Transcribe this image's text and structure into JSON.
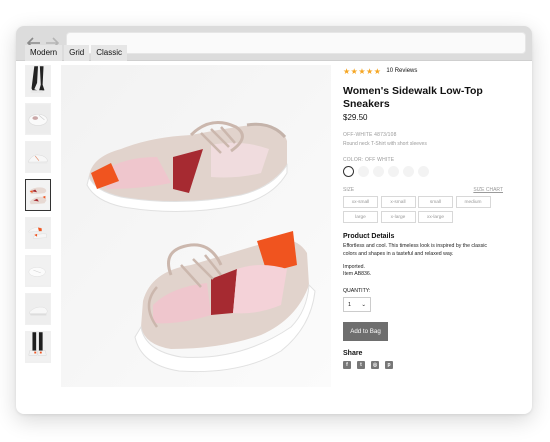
{
  "browser": {
    "back_icon": "arrow-left-icon",
    "forward_icon": "arrow-right-icon",
    "url": ""
  },
  "layout_tabs": [
    "Modern",
    "Grid",
    "Classic"
  ],
  "thumbnails": [
    {
      "name": "legs-black"
    },
    {
      "name": "shoe-top-white"
    },
    {
      "name": "shoe-side-white"
    },
    {
      "name": "shoes-pair",
      "active": true
    },
    {
      "name": "shoes-orange"
    },
    {
      "name": "shoe-top-light"
    },
    {
      "name": "shoe-sole"
    },
    {
      "name": "feet-model"
    }
  ],
  "product": {
    "stars": "★★★★★",
    "rating": 5,
    "reviews": "10 Reviews",
    "title": "Women's Sidewalk Low-Top Sneakers",
    "price": "$29.50",
    "sku": "OFF-WHITE 4873/108",
    "subtitle": "Round neck T-Shirt with short sleeves",
    "color_label": "COLOR: OFF WHITE",
    "swatch_count": 4,
    "size_label": "SIZE",
    "size_chart": "SIZE CHART",
    "sizes": [
      "xx-small",
      "x-small",
      "small",
      "medium",
      "large",
      "x-large",
      "xx-large"
    ],
    "details_heading": "Product Details",
    "details_text": "Effortless and cool. This timeless look is inspired by the classic colors and shapes in a tasteful and relaxed way.",
    "imported": "Imported.",
    "item": "Item AB836.",
    "quantity_label": "QUANTITY:",
    "quantity_value": "1",
    "add_to_bag": "Add to Bag",
    "share_heading": "Share",
    "share_icons": [
      "facebook-icon",
      "twitter-icon",
      "instagram-icon",
      "pinterest-icon"
    ]
  },
  "colors": {
    "browser_bar": "#dcdcdc",
    "star": "#f5a623",
    "button": "#6e6e6e",
    "shoe_pink": "#efc6cd",
    "shoe_orange": "#f0541f",
    "shoe_red": "#a62a31",
    "shoe_beige": "#d6c9c2"
  }
}
